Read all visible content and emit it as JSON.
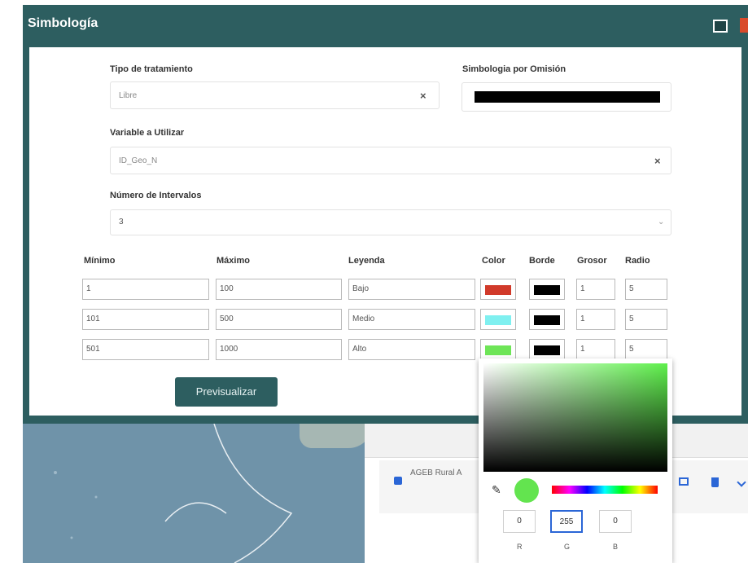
{
  "dialog": {
    "title": "Simbología"
  },
  "form": {
    "tipo_label": "Tipo de tratamiento",
    "tipo_value": "Libre",
    "omision_label": "Simbologia por Omisión",
    "variable_label": "Variable a Utilizar",
    "variable_value": "ID_Geo_N",
    "intervalos_label": "Número de Intervalos",
    "intervalos_value": "3",
    "clear_glyph": "×",
    "chevron_glyph": "⌄"
  },
  "table": {
    "headers": {
      "minimo": "Mínimo",
      "maximo": "Máximo",
      "leyenda": "Leyenda",
      "color": "Color",
      "borde": "Borde",
      "grosor": "Grosor",
      "radio": "Radio"
    },
    "rows": [
      {
        "min": "1",
        "max": "100",
        "leyenda": "Bajo",
        "color": "#d13a2a",
        "borde": "#000000",
        "grosor": "1",
        "radio": "5"
      },
      {
        "min": "101",
        "max": "500",
        "leyenda": "Medio",
        "color": "#7ff0f0",
        "borde": "#000000",
        "grosor": "1",
        "radio": "5"
      },
      {
        "min": "501",
        "max": "1000",
        "leyenda": "Alto",
        "color": "#6ee557",
        "borde": "#000000",
        "grosor": "1",
        "radio": "5"
      }
    ]
  },
  "buttons": {
    "preview": "Previsualizar"
  },
  "layers": {
    "item_label": "AGEB Rural A"
  },
  "picker": {
    "r": "0",
    "g": "255",
    "b": "0",
    "r_label": "R",
    "g_label": "G",
    "b_label": "B"
  },
  "colors": {
    "dialog": "#2d5e60",
    "accent": "#2b66d6"
  }
}
